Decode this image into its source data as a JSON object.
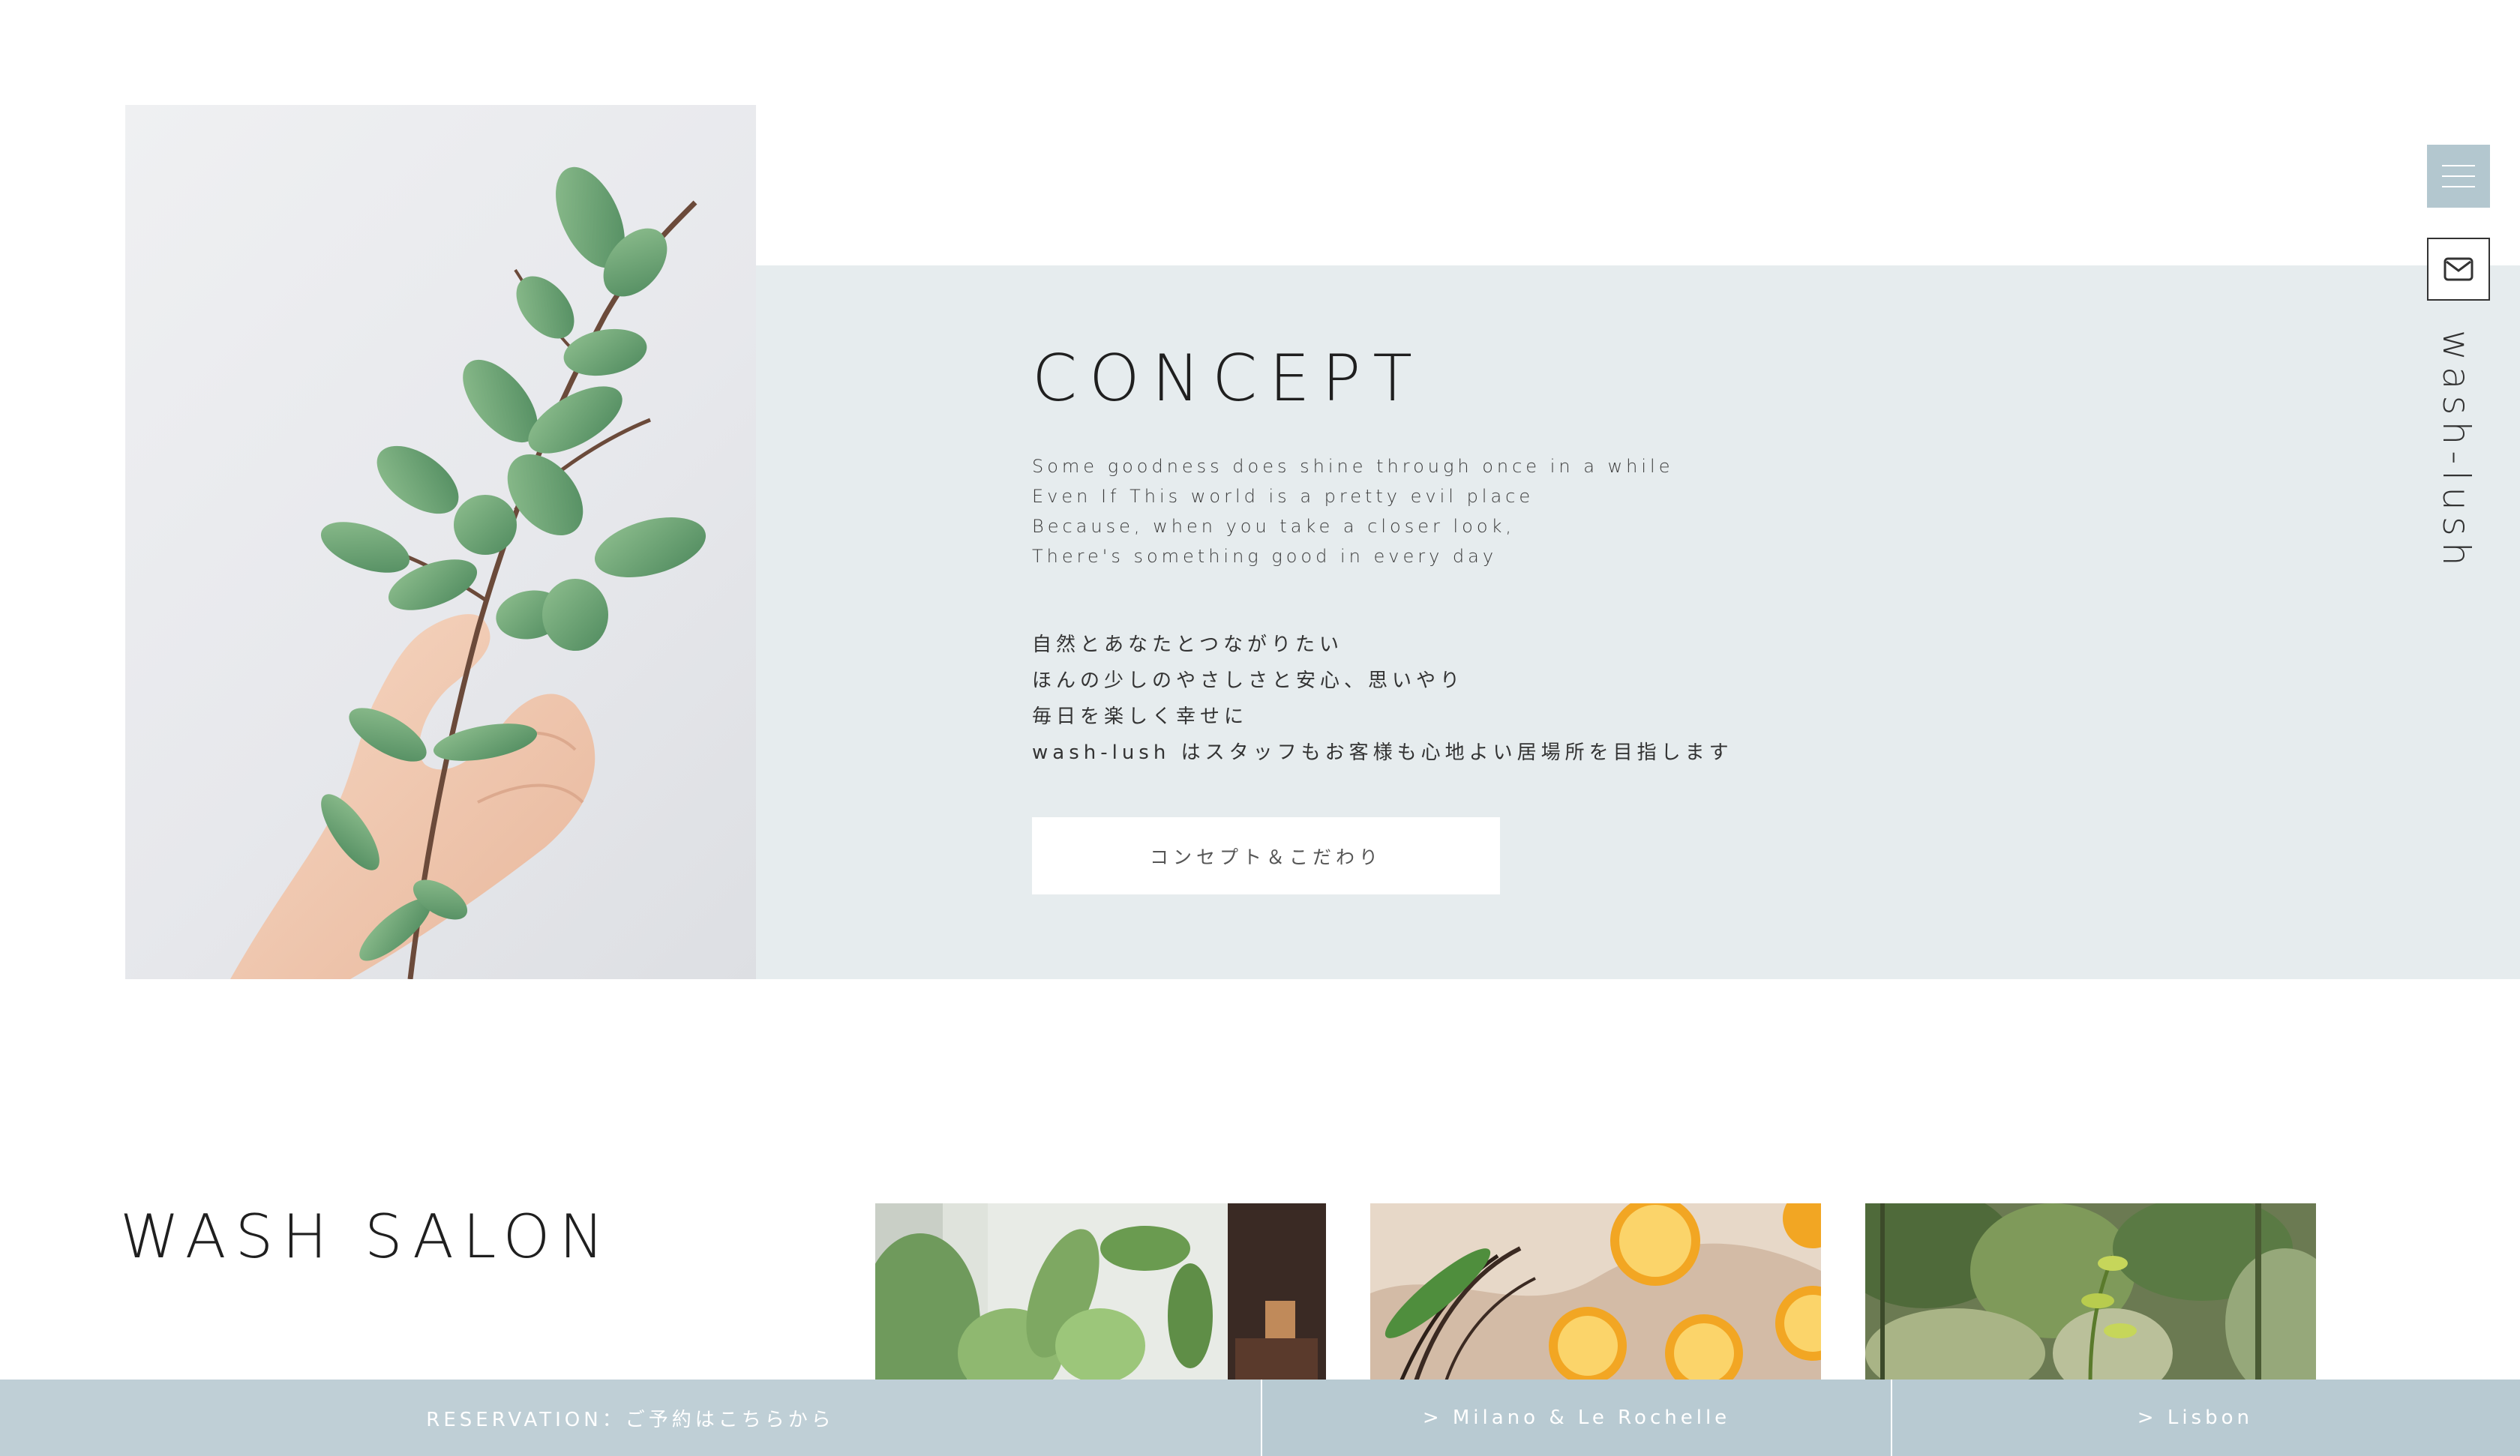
{
  "concept": {
    "title": "CONCEPT",
    "english_lines": [
      "Some goodness does shine through once in a while",
      "Even If This world is a pretty evil place",
      "Because, when you take a closer look,",
      "There's something good in every day"
    ],
    "japanese_lines": [
      "自然とあなたとつながりたい",
      "ほんの少しのやさしさと安心、思いやり",
      "毎日を楽しく幸せに",
      "wash-lush はスタッフもお客様も心地よい居場所を目指します"
    ],
    "button_label": "コンセプト＆こだわり"
  },
  "sidebar": {
    "brand": "wash-lush",
    "menu_icon": "hamburger-icon",
    "mail_icon": "mail-icon"
  },
  "salon": {
    "title": "WASH SALON"
  },
  "bottom_bar": {
    "reservation": "RESERVATION：ご予約はこちらから",
    "milano": "> Milano & Le Rochelle",
    "lisbon": "> Lisbon"
  },
  "colors": {
    "accent": "#b3c7cf",
    "band": "#e6ecee",
    "bar": "#b8cad2"
  }
}
